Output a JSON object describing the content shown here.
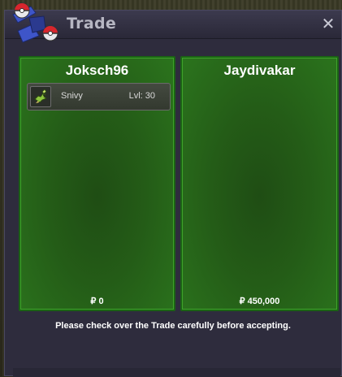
{
  "window": {
    "title": "Trade",
    "close_glyph": "✕",
    "logo_icon": "pokeball-logo-icon"
  },
  "left_panel": {
    "player_name": "Joksch96",
    "pokemon": [
      {
        "name": "Snivy",
        "level": "Lvl: 30",
        "icon": "snivy-icon"
      }
    ],
    "money": "₽ 0"
  },
  "right_panel": {
    "player_name": "Jaydivakar",
    "pokemon": [],
    "money": "₽ 450,000"
  },
  "notice": "Please check over the Trade carefully before accepting.",
  "colors": {
    "panel_green": "#245c17",
    "panel_border": "#1b6314",
    "window_bg": "#2e2c3d",
    "title_text": "#b7b7c3"
  }
}
